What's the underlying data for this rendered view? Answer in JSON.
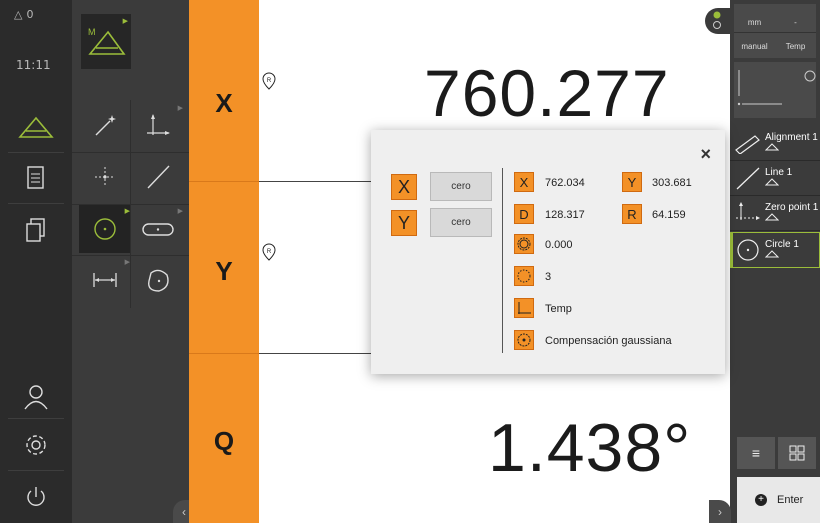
{
  "status": {
    "triangle_value": "0",
    "time": "11:11"
  },
  "axes": {
    "x_label": "X",
    "y_label": "Y",
    "q_label": "Q",
    "x_value": "760.277",
    "q_value": "1.438°",
    "reference_badge": "R"
  },
  "right_panel": {
    "unit": "mm",
    "dash": "-",
    "mode": "manual",
    "temp": "Temp",
    "features": [
      {
        "label": "Alignment 1"
      },
      {
        "label": "Line 1"
      },
      {
        "label": "Zero point 1"
      },
      {
        "label": "Circle 1"
      }
    ],
    "enter_label": "Enter"
  },
  "dialog": {
    "x_axis": "X",
    "y_axis": "Y",
    "cero_label": "cero",
    "x": {
      "tag": "X",
      "value": "762.034"
    },
    "y": {
      "tag": "Y",
      "value": "303.681"
    },
    "d": {
      "tag": "D",
      "value": "128.317"
    },
    "r": {
      "tag": "R",
      "value": "64.159"
    },
    "form_error": "0.000",
    "point_count": "3",
    "reference": "Temp",
    "fit_method": "Compensación gaussiana"
  },
  "colors": {
    "accent_orange": "#f39127",
    "accent_green": "#9bbd3a",
    "rail_dark": "#2b2b2b",
    "palette_gray": "#3b3b3b"
  }
}
